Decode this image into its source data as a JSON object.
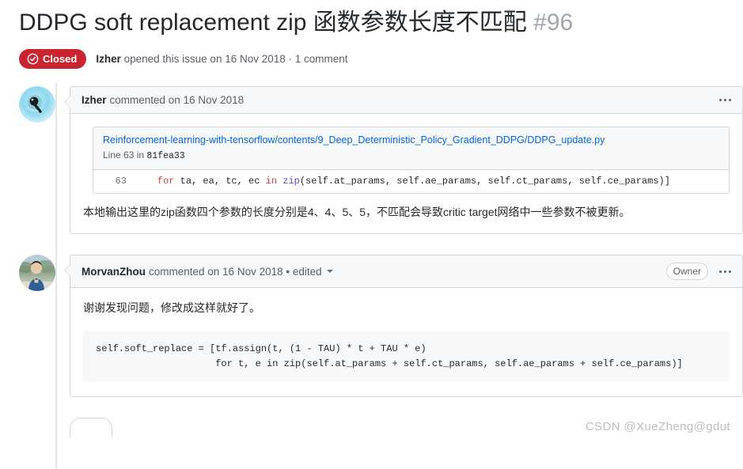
{
  "issue": {
    "title": "DDPG soft replacement zip 函数参数长度不匹配",
    "number": "#96",
    "state_label": "Closed",
    "state_color": "#cb2431",
    "opened_author": "Izher",
    "opened_meta": " opened this issue on 16 Nov 2018 · 1 comment"
  },
  "comments": [
    {
      "author": "Izher",
      "meta": "commented on 16 Nov 2018",
      "code_ref": {
        "path": "Reinforcement-learning-with-tensorflow/contents/9_Deep_Deterministic_Policy_Gradient_DDPG/DDPG_update.py",
        "line_prefix": "Line 63 in ",
        "commit": "81fea33",
        "line_number": "63",
        "code_indent": "    ",
        "kw_for": "for",
        "code_vars": " ta, ea, tc, ec ",
        "kw_in": "in",
        "fn_zip": " zip",
        "code_rest": "(self.at_params, self.ae_params, self.ct_params, self.ce_params)]"
      },
      "body_text": "本地输出这里的zip函数四个参数的长度分别是4、4、5、5，不匹配会导致critic target网络中一些参数不被更新。"
    },
    {
      "author": "MorvanZhou",
      "meta": "commented on 16 Nov 2018 • edited",
      "owner_badge": "Owner",
      "body_text": "谢谢发现问题，修改成这样就好了。",
      "code_block": "self.soft_replace = [tf.assign(t, (1 - TAU) * t + TAU * e)\n                     for t, e in zip(self.at_params + self.ct_params, self.ae_params + self.ce_params)]"
    }
  ],
  "watermark": "CSDN @XueZheng@gdut"
}
